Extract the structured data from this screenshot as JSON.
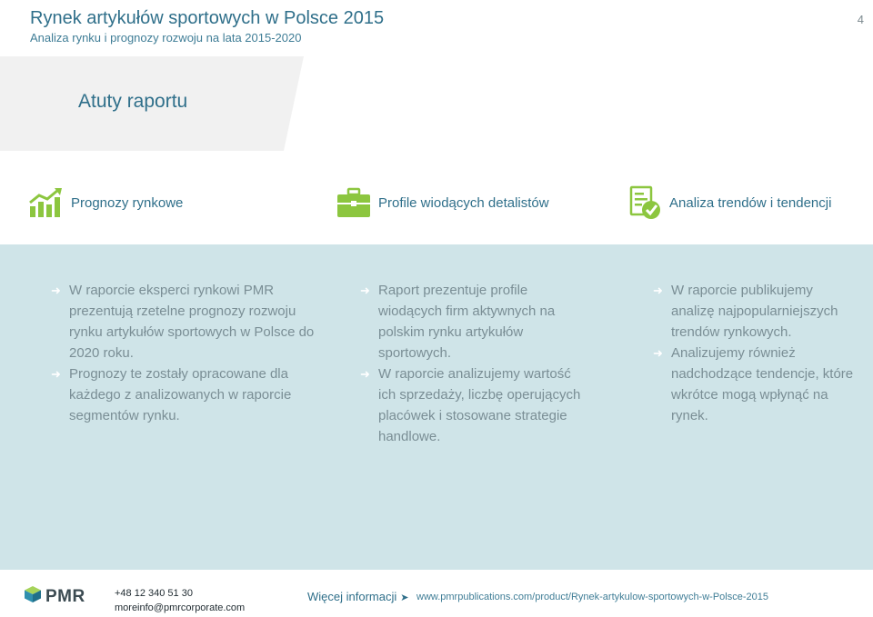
{
  "header": {
    "title": "Rynek artykułów sportowych w Polsce 2015",
    "subtitle": "Analiza rynku i prognozy rozwoju na lata 2015-2020",
    "page_number": "4"
  },
  "section": {
    "title": "Atuty raportu"
  },
  "features": [
    {
      "label": "Prognozy rynkowe",
      "icon": "chart-growth-icon"
    },
    {
      "label": "Profile wiodących detalistów",
      "icon": "briefcase-icon"
    },
    {
      "label": "Analiza trendów i tendencji",
      "icon": "document-check-icon"
    }
  ],
  "columns": [
    {
      "bullets": [
        "W raporcie eksperci rynkowi PMR prezentują rzetelne prognozy rozwoju rynku artykułów sportowych w Polsce do 2020 roku.",
        "Prognozy te zostały opracowane dla każdego z analizowanych w raporcie segmentów rynku."
      ]
    },
    {
      "bullets": [
        "Raport prezentuje profile wiodących firm aktywnych na polskim rynku artykułów sportowych.",
        "W raporcie analizujemy wartość ich sprzedaży, liczbę operujących placówek i stosowane strategie handlowe."
      ]
    },
    {
      "bullets": [
        "W raporcie publikujemy analizę najpopularniejszych trendów rynkowych.",
        "Analizujemy również nadchodzące tendencje, które wkrótce mogą wpłynąć na rynek."
      ]
    }
  ],
  "footer": {
    "logo_text": "PMR",
    "phone": "+48 12 340 51 30",
    "email": "moreinfo@pmrcorporate.com",
    "more_label": "Więcej informacji",
    "url": "www.pmrpublications.com/product/Rynek-artykulow-sportowych-w-Polsce-2015"
  },
  "colors": {
    "accent": "#2f6f8a",
    "green": "#8cc63f",
    "panel": "#cfe4e8"
  }
}
